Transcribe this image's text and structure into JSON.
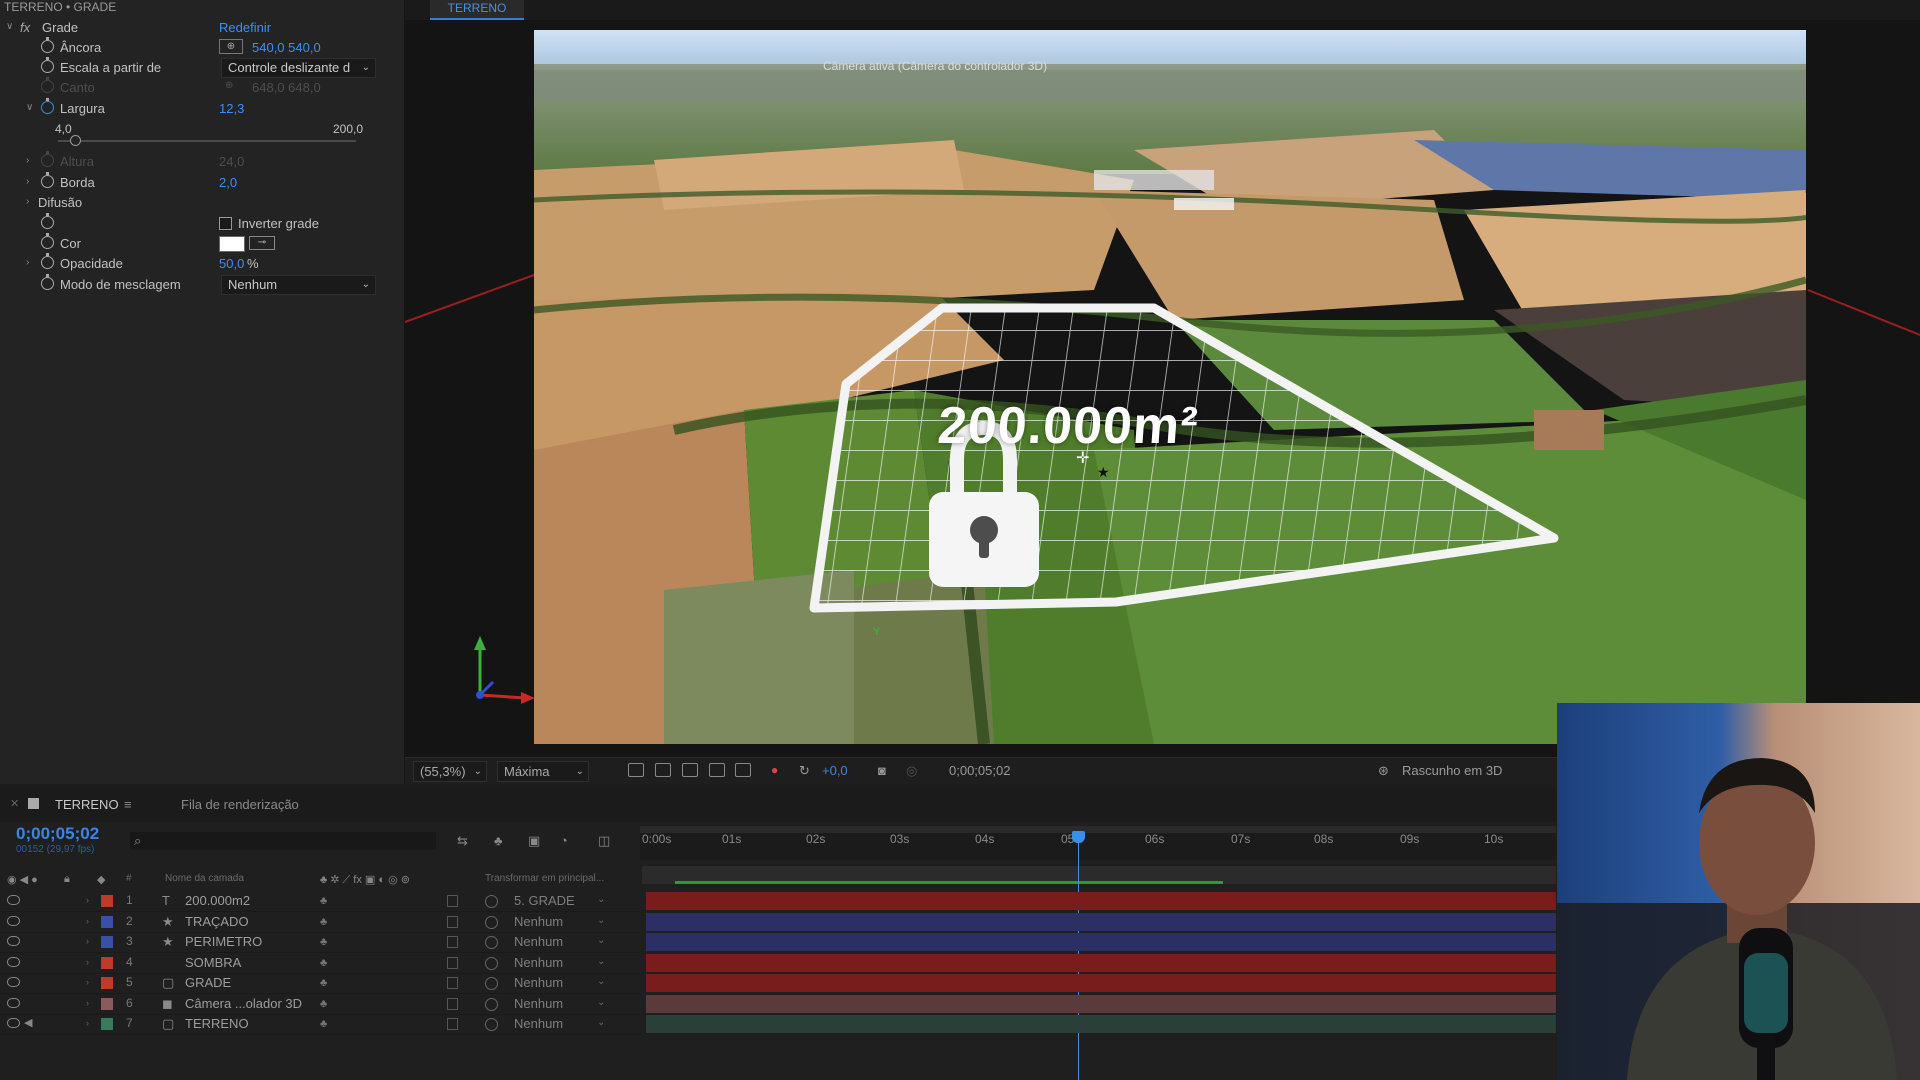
{
  "effect_controls": {
    "header": "TERRENO • GRADE",
    "effect_name": "Grade",
    "fx_symbol": "fx",
    "reset_label": "Redefinir",
    "anchor": {
      "label": "Âncora",
      "value": "540,0 540,0"
    },
    "scale_from": {
      "label": "Escala a partir de",
      "value": "Controle deslizante d"
    },
    "corner": {
      "label": "Canto",
      "value": "648,0 648,0"
    },
    "width": {
      "label": "Largura",
      "value": "12,3",
      "slider_min": "4,0",
      "slider_max": "200,0"
    },
    "height": {
      "label": "Altura",
      "value": "24,0"
    },
    "border": {
      "label": "Borda",
      "value": "2,0"
    },
    "feather": {
      "label": "Difusão"
    },
    "invert": {
      "label": "Inverter grade",
      "checked": false
    },
    "color": {
      "label": "Cor",
      "swatch": "#ffffff"
    },
    "opacity": {
      "label": "Opacidade",
      "value": "50,0",
      "unit": "%"
    },
    "blend": {
      "label": "Modo de mesclagem",
      "value": "Nenhum"
    }
  },
  "viewer": {
    "comp_tab": "TERRENO",
    "camera_label": "Câmera ativa (Câmera do controlador 3D)",
    "overlay_area_text": "200.000m²",
    "toolbar": {
      "zoom": "(55,3%)",
      "resolution": "Máxima",
      "exposure": "+0,0",
      "timecode": "0;00;05;02",
      "draft3d": "Rascunho em 3D"
    },
    "axis": {
      "y": "Y"
    }
  },
  "timeline": {
    "tab_comp": "TERRENO",
    "tab_render": "Fila de renderização",
    "timecode": "0;00;05;02",
    "fps": "00152 (29,97 fps)",
    "col_name": "Nome da camada",
    "col_parent": "Transformar em principal...",
    "col_num": "#",
    "ruler": [
      "0:00s",
      "01s",
      "02s",
      "03s",
      "04s",
      "05s",
      "06s",
      "07s",
      "08s",
      "09s",
      "10s"
    ],
    "layers": [
      {
        "num": "1",
        "type": "T",
        "name": "200.000m2",
        "label_color": "#c0392b",
        "parent": "5. GRADE",
        "bar": "#7a1c1c"
      },
      {
        "num": "2",
        "type": "★",
        "name": "TRAÇADO",
        "label_color": "#3a4fa8",
        "parent": "Nenhum",
        "bar": "#2c2f63"
      },
      {
        "num": "3",
        "type": "★",
        "name": "PERIMETRO",
        "label_color": "#3a4fa8",
        "parent": "Nenhum",
        "bar": "#2c2f63"
      },
      {
        "num": "4",
        "type": "",
        "name": "SOMBRA",
        "label_color": "#c0392b",
        "parent": "Nenhum",
        "bar": "#7a1c1c"
      },
      {
        "num": "5",
        "type": "▢",
        "name": "GRADE",
        "label_color": "#c0392b",
        "parent": "Nenhum",
        "bar": "#7a1c1c"
      },
      {
        "num": "6",
        "type": "◼",
        "name": "Câmera ...olador 3D",
        "label_color": "#8c5a5a",
        "parent": "Nenhum",
        "bar": "#5a3a3a"
      },
      {
        "num": "7",
        "type": "▢",
        "name": "TERRENO",
        "label_color": "#3a7a5a",
        "parent": "Nenhum",
        "bar": "#2a3f38"
      }
    ]
  }
}
